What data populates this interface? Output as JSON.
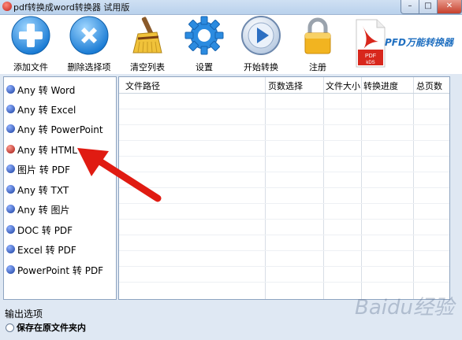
{
  "window": {
    "title": "pdf转换成word转换器 试用版",
    "minimize": "–",
    "maximize": "□",
    "close": "✕"
  },
  "toolbar": {
    "add_file": "添加文件",
    "remove_selected": "删除选择项",
    "clear_list": "清空列表",
    "settings": "设置",
    "start": "开始转换",
    "register": "注册"
  },
  "brand": {
    "text": "PFD万能转换器",
    "logo_lines": [
      "PDF",
      "kDS"
    ]
  },
  "conversions": [
    {
      "label": "Any 转 Word",
      "active": false
    },
    {
      "label": "Any 转 Excel",
      "active": false
    },
    {
      "label": "Any 转 PowerPoint",
      "active": false
    },
    {
      "label": "Any 转 HTML",
      "active": true
    },
    {
      "label": "图片 转 PDF",
      "active": false
    },
    {
      "label": "Any 转 TXT",
      "active": false
    },
    {
      "label": "Any 转 图片",
      "active": false
    },
    {
      "label": "DOC 转 PDF",
      "active": false
    },
    {
      "label": "Excel 转 PDF",
      "active": false
    },
    {
      "label": "PowerPoint 转 PDF",
      "active": false
    }
  ],
  "table": {
    "columns": [
      "文件路径",
      "页数选择",
      "文件大小",
      "转换进度",
      "总页数"
    ],
    "rows": []
  },
  "output": {
    "label": "输出选项",
    "option": "保存在原文件夹内"
  },
  "watermark": "Baidu经验",
  "colors": {
    "accent_blue": "#1f6fc0",
    "list_dot_blue": "#1a3e9e",
    "list_dot_red": "#a11610",
    "arrow_red": "#e01b12"
  }
}
